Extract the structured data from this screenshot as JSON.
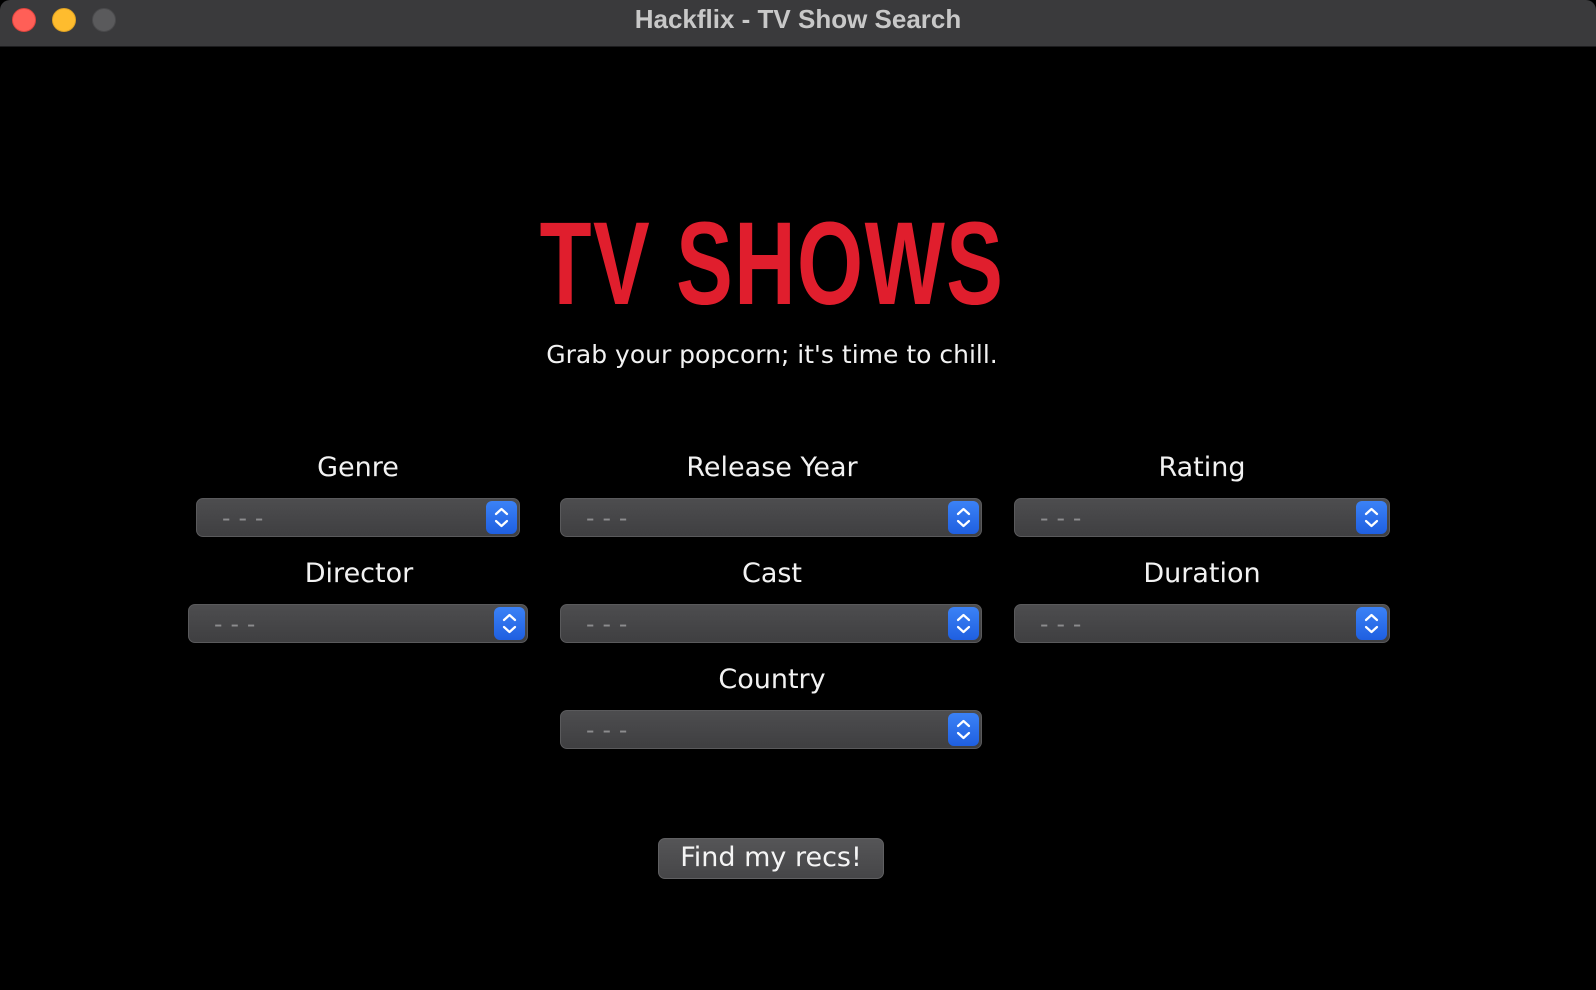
{
  "window": {
    "title": "Hackflix - TV Show Search"
  },
  "header": {
    "logo": "TV SHOWS",
    "tagline": "Grab your popcorn; it's time to chill."
  },
  "filters": {
    "genre": {
      "label": "Genre",
      "value": "---"
    },
    "release_year": {
      "label": "Release Year",
      "value": "---"
    },
    "rating": {
      "label": "Rating",
      "value": "---"
    },
    "director": {
      "label": "Director",
      "value": "---"
    },
    "cast": {
      "label": "Cast",
      "value": "---"
    },
    "duration": {
      "label": "Duration",
      "value": "---"
    },
    "country": {
      "label": "Country",
      "value": "---"
    }
  },
  "actions": {
    "submit_label": "Find my recs!"
  },
  "colors": {
    "logo": "#e01e2d",
    "accent": "#2563eb",
    "background": "#000000"
  }
}
